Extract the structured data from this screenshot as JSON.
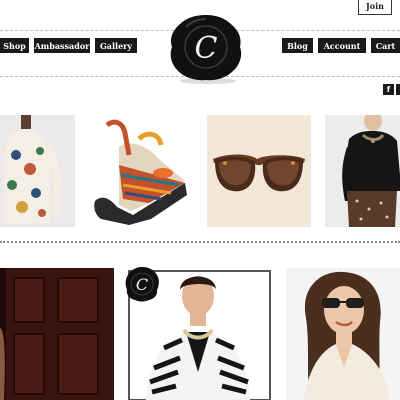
{
  "header": {
    "join_label": "Join",
    "logo_letter": "C",
    "nav_left": [
      {
        "label": "Shop"
      },
      {
        "label": "Ambassador"
      },
      {
        "label": "Gallery"
      }
    ],
    "nav_right": [
      {
        "label": "Blog"
      },
      {
        "label": "Account"
      },
      {
        "label": "Cart"
      }
    ],
    "social_icons": [
      "facebook-icon",
      "twitter-icon"
    ]
  },
  "products": [
    {
      "icon": "floral-top-image"
    },
    {
      "icon": "wedge-sandal-image"
    },
    {
      "icon": "sunglasses-image"
    },
    {
      "icon": "black-sweater-image"
    }
  ],
  "features": [
    {
      "icon": "dark-wood-room-image"
    },
    {
      "icon": "zebra-jacket-model-image",
      "badge_letter": "C"
    },
    {
      "icon": "sunglasses-model-image"
    }
  ],
  "colors": {
    "nav_background": "#1a1a1a",
    "seal": "#111111",
    "page_background": "#ffffff"
  }
}
